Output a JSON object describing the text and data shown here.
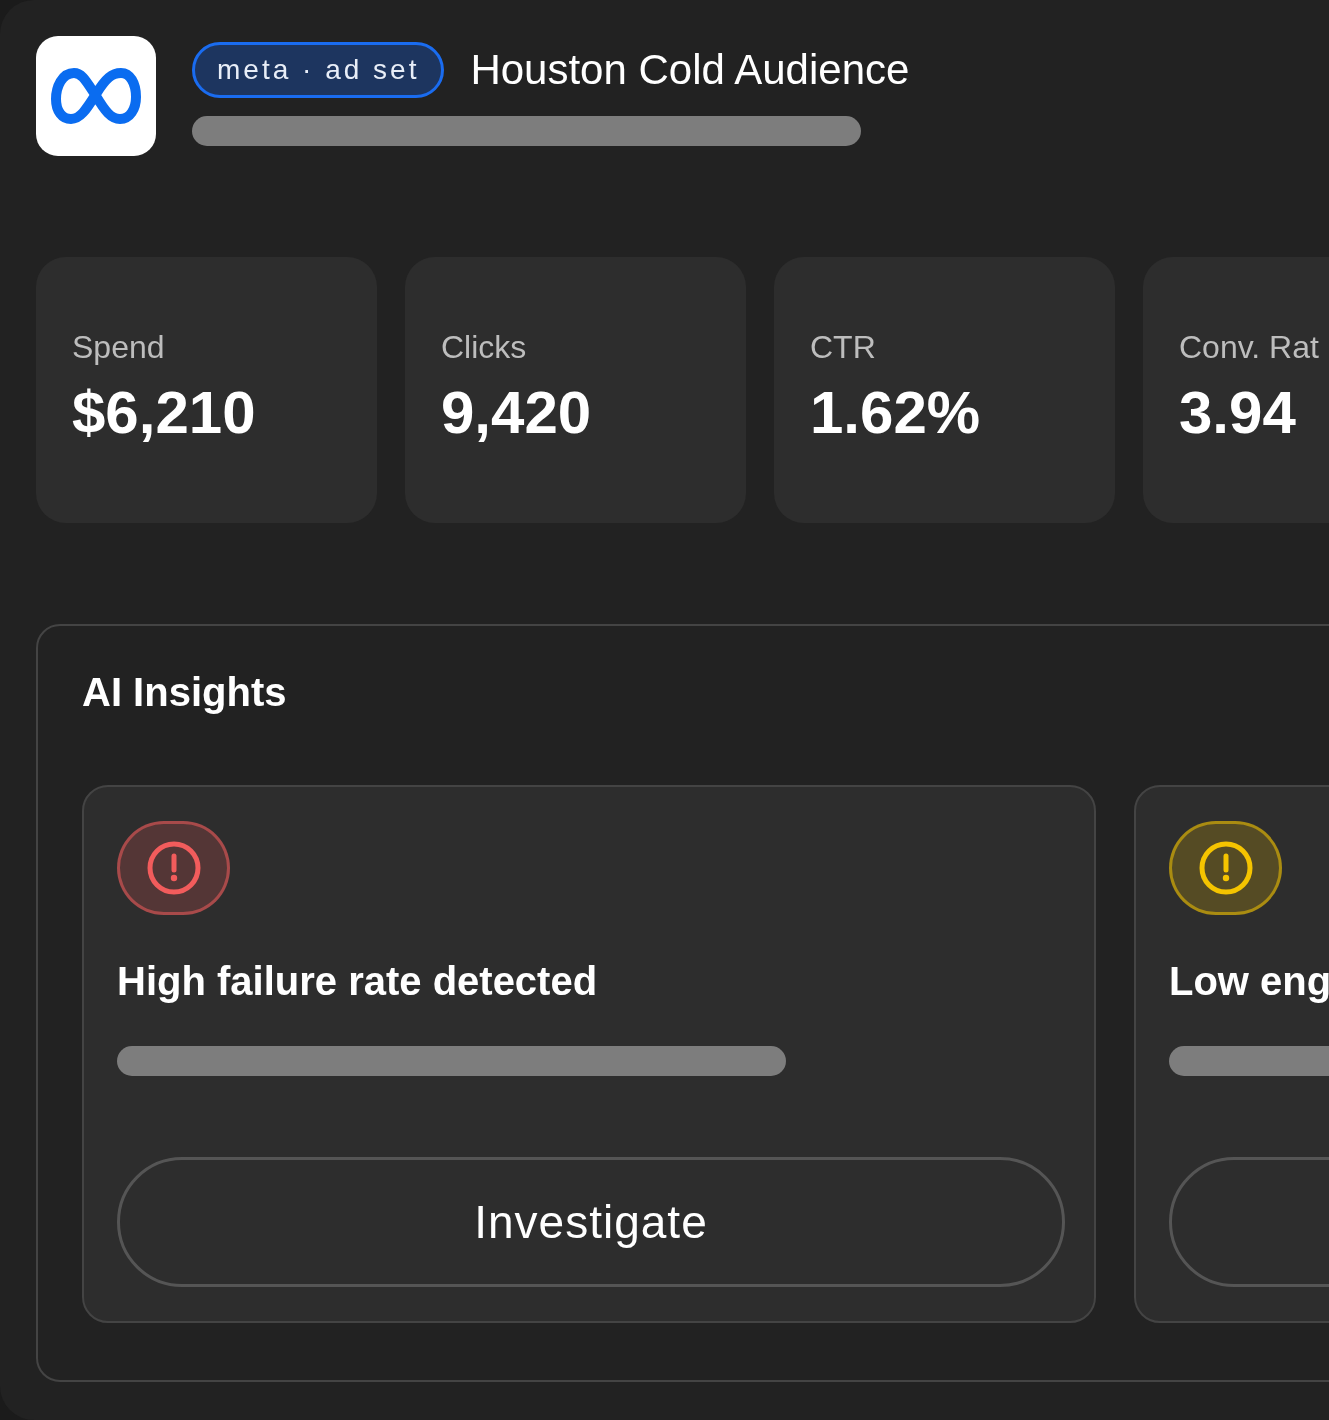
{
  "header": {
    "badge": "meta · ad set",
    "title": "Houston Cold Audience"
  },
  "stats": [
    {
      "label": "Spend",
      "value": "$6,210"
    },
    {
      "label": "Clicks",
      "value": "9,420"
    },
    {
      "label": "CTR",
      "value": "1.62%"
    },
    {
      "label": "Conv. Rat",
      "value": "3.94"
    }
  ],
  "insights": {
    "title": "AI Insights",
    "items": [
      {
        "title": "High failure rate detected",
        "color": "#f25c5c",
        "action": "Investigate"
      },
      {
        "title": "Low eng",
        "color": "#f5c400"
      }
    ]
  }
}
